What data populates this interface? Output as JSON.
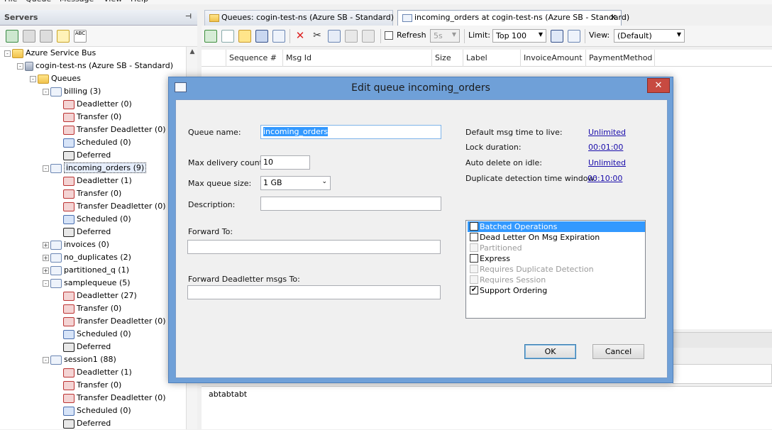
{
  "menubar": [
    "File",
    "Queue",
    "Message",
    "View",
    "Help"
  ],
  "left_panel": {
    "title": "Servers",
    "tree": [
      {
        "label": "Azure Service Bus",
        "icon": "folder",
        "level": 0,
        "expander": "-"
      },
      {
        "label": "cogin-test-ns (Azure SB - Standard)",
        "icon": "server",
        "level": 1,
        "expander": "-"
      },
      {
        "label": "Queues",
        "icon": "folder",
        "level": 2,
        "expander": "-"
      },
      {
        "label": "billing (3)",
        "icon": "mail",
        "level": 3,
        "expander": "-"
      },
      {
        "label": "Deadletter (0)",
        "icon": "red",
        "level": 4
      },
      {
        "label": "Transfer (0)",
        "icon": "red",
        "level": 4
      },
      {
        "label": "Transfer Deadletter (0)",
        "icon": "red",
        "level": 4
      },
      {
        "label": "Scheduled (0)",
        "icon": "blue",
        "level": 4
      },
      {
        "label": "Deferred",
        "icon": "black",
        "level": 4
      },
      {
        "label": "incoming_orders (9)",
        "icon": "mail",
        "level": 3,
        "expander": "-",
        "selected": true
      },
      {
        "label": "Deadletter (1)",
        "icon": "red",
        "level": 4
      },
      {
        "label": "Transfer (0)",
        "icon": "red",
        "level": 4
      },
      {
        "label": "Transfer Deadletter (0)",
        "icon": "red",
        "level": 4
      },
      {
        "label": "Scheduled (0)",
        "icon": "blue",
        "level": 4
      },
      {
        "label": "Deferred",
        "icon": "black",
        "level": 4
      },
      {
        "label": "invoices (0)",
        "icon": "mail",
        "level": 3,
        "expander": "+"
      },
      {
        "label": "no_duplicates (2)",
        "icon": "mail",
        "level": 3,
        "expander": "+"
      },
      {
        "label": "partitioned_q (1)",
        "icon": "mail",
        "level": 3,
        "expander": "+"
      },
      {
        "label": "samplequeue (5)",
        "icon": "mail",
        "level": 3,
        "expander": "-"
      },
      {
        "label": "Deadletter (27)",
        "icon": "red",
        "level": 4
      },
      {
        "label": "Transfer (0)",
        "icon": "red",
        "level": 4
      },
      {
        "label": "Transfer Deadletter (0)",
        "icon": "red",
        "level": 4
      },
      {
        "label": "Scheduled (0)",
        "icon": "blue",
        "level": 4
      },
      {
        "label": "Deferred",
        "icon": "black",
        "level": 4
      },
      {
        "label": "session1 (88)",
        "icon": "mail",
        "level": 3,
        "expander": "-"
      },
      {
        "label": "Deadletter (1)",
        "icon": "red",
        "level": 4
      },
      {
        "label": "Transfer (0)",
        "icon": "red",
        "level": 4
      },
      {
        "label": "Transfer Deadletter (0)",
        "icon": "red",
        "level": 4
      },
      {
        "label": "Scheduled (0)",
        "icon": "blue",
        "level": 4
      },
      {
        "label": "Deferred",
        "icon": "black",
        "level": 4
      }
    ]
  },
  "tabs": [
    {
      "label": "Queues: cogin-test-ns (Azure SB - Standard)",
      "active": false
    },
    {
      "label": "incoming_orders at cogin-test-ns (Azure SB - Standard)",
      "active": true,
      "close": "✕"
    }
  ],
  "toolbar": {
    "refresh_label": "Refresh",
    "refresh_interval": "5s",
    "limit_label": "Limit:",
    "limit_value": "Top 100",
    "view_label": "View:",
    "view_value": "(Default)"
  },
  "grid": {
    "columns": [
      "Sequence #",
      "Msg Id",
      "Size",
      "Label",
      "InvoiceAmount",
      "PaymentMethod"
    ]
  },
  "bottom_text": "abtabtabt",
  "dialog": {
    "title": "Edit queue incoming_orders",
    "close": "✕",
    "queue_name_label": "Queue name:",
    "queue_name_value": "incoming_orders",
    "max_delivery_label": "Max delivery count:",
    "max_delivery_value": "10",
    "max_queue_size_label": "Max queue size:",
    "max_queue_size_value": "1 GB",
    "description_label": "Description:",
    "description_value": "",
    "forward_to_label": "Forward To:",
    "forward_to_value": "",
    "forward_deadletter_label": "Forward Deadletter msgs To:",
    "forward_deadletter_value": "",
    "time_settings": [
      {
        "label": "Default msg time to live:",
        "value": "Unlimited"
      },
      {
        "label": "Lock duration:",
        "value": "00:01:00"
      },
      {
        "label": "Auto delete on idle:",
        "value": "Unlimited"
      },
      {
        "label": "Duplicate detection time window:",
        "value": "00:10:00"
      }
    ],
    "options": [
      {
        "label": "Batched Operations",
        "checked": true,
        "enabled": true,
        "selected": true
      },
      {
        "label": "Dead Letter On Msg Expiration",
        "checked": false,
        "enabled": true
      },
      {
        "label": "Partitioned",
        "checked": false,
        "enabled": false
      },
      {
        "label": "Express",
        "checked": false,
        "enabled": true
      },
      {
        "label": "Requires Duplicate Detection",
        "checked": false,
        "enabled": false
      },
      {
        "label": "Requires Session",
        "checked": false,
        "enabled": false
      },
      {
        "label": "Support Ordering",
        "checked": true,
        "enabled": true
      }
    ],
    "ok_label": "OK",
    "cancel_label": "Cancel"
  }
}
